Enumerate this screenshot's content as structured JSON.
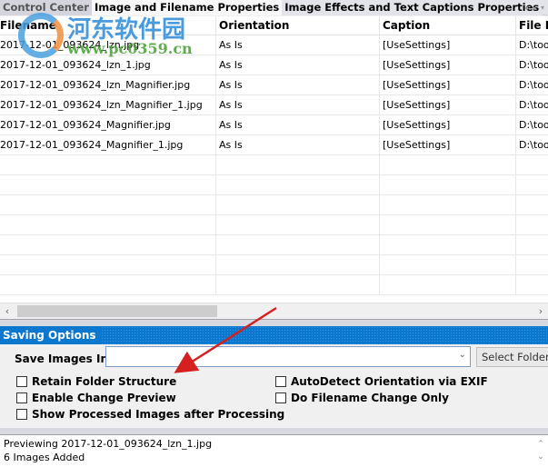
{
  "tabs": [
    {
      "label": "Control Center",
      "active": false
    },
    {
      "label": "Image and Filename Properties",
      "active": true
    },
    {
      "label": "Image Effects and Text Captions Properties",
      "active": false
    }
  ],
  "tab_nav": {
    "prev": "◂",
    "next": "▸",
    "menu": "▾"
  },
  "grid": {
    "columns": [
      "Filename",
      "Orientation",
      "Caption",
      "File Path"
    ],
    "rows": [
      [
        "2017-12-01_093624_lzn.jpg",
        "As Is",
        "[UseSettings]",
        "D:\\tools"
      ],
      [
        "2017-12-01_093624_lzn_1.jpg",
        "As Is",
        "[UseSettings]",
        "D:\\tools"
      ],
      [
        "2017-12-01_093624_lzn_Magnifier.jpg",
        "As Is",
        "[UseSettings]",
        "D:\\tools"
      ],
      [
        "2017-12-01_093624_lzn_Magnifier_1.jpg",
        "As Is",
        "[UseSettings]",
        "D:\\tools"
      ],
      [
        "2017-12-01_093624_Magnifier.jpg",
        "As Is",
        "[UseSettings]",
        "D:\\tools"
      ],
      [
        "2017-12-01_093624_Magnifier_1.jpg",
        "As Is",
        "[UseSettings]",
        "D:\\tools"
      ]
    ]
  },
  "scroll": {
    "left": "‹",
    "right": "›"
  },
  "saving_options": {
    "title": "Saving Options",
    "save_images_in_label": "Save Images In",
    "save_images_in_value": "",
    "select_folder_label": "Select Folder",
    "dropdown_chevron": "⌄",
    "checkboxes": [
      {
        "label": "Retain Folder Structure",
        "checked": false
      },
      {
        "label": "Enable Change Preview",
        "checked": false
      },
      {
        "label": "Show Processed Images after Processing",
        "checked": false
      },
      {
        "label": "AutoDetect Orientation via EXIF",
        "checked": false
      },
      {
        "label": "Do Filename Change Only",
        "checked": false
      }
    ]
  },
  "log": {
    "lines": [
      "Previewing 2017-12-01_093624_lzn_1.jpg",
      "6 Images Added"
    ],
    "scroll_up": "⌃",
    "scroll_down": "⌄"
  },
  "watermark": {
    "title": "河东软件园",
    "url": "www.pc0359.cn"
  },
  "colors": {
    "section_header": "#0b78d0",
    "annotation_arrow": "#d42020"
  }
}
